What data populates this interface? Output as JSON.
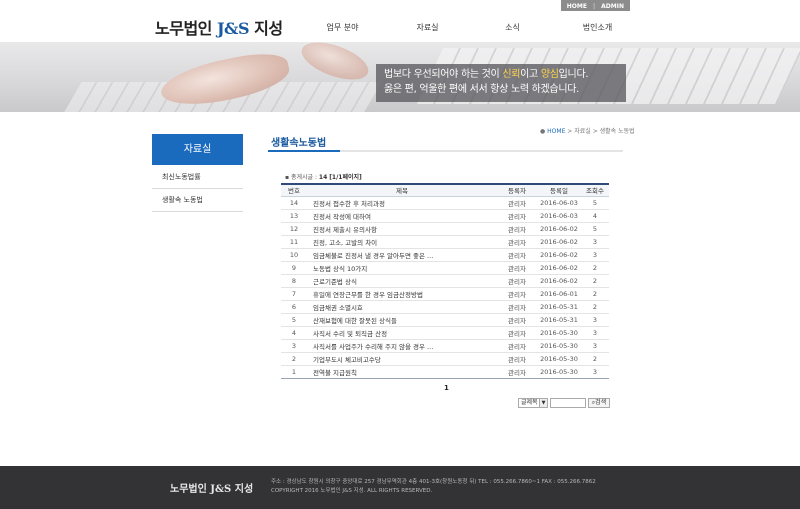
{
  "util": {
    "home": "HOME",
    "sep": "|",
    "admin": "ADMIN"
  },
  "header": {
    "logo_main": "노무법인 ",
    "logo_js": "J&S",
    "logo_tail": " 지성"
  },
  "nav": [
    "업무 분야",
    "자료실",
    "소식",
    "법인소개"
  ],
  "hero": {
    "line1_a": "법보다 우선되어야 하는 것이 ",
    "line1_hl1": "신뢰",
    "line1_b": "이고 ",
    "line1_hl2": "양심",
    "line1_c": "입니다.",
    "line2": "옳은 편, 억울한 편에 서서 항상 노력 하겠습니다."
  },
  "sidebar": {
    "title": "자료실",
    "items": [
      "최신노동법률",
      "생활속 노동법"
    ]
  },
  "page": {
    "title": "생활속노동법",
    "breadcrumb": {
      "home": "HOME",
      "sep1": " > ",
      "crumb1": "자료실",
      "sep2": " > ",
      "crumb2": "생활속 노동법"
    },
    "total_label": "총게시글 : ",
    "total_value": "14",
    "total_pages": "[1/1페이지]"
  },
  "board": {
    "headers": [
      "번호",
      "제목",
      "등록자",
      "등록일",
      "조회수"
    ],
    "rows": [
      {
        "no": "14",
        "title": "진정서 접수한 후 처리과정",
        "author": "관리자",
        "date": "2016-06-03",
        "views": "5"
      },
      {
        "no": "13",
        "title": "진정서 작성에 대하여",
        "author": "관리자",
        "date": "2016-06-03",
        "views": "4"
      },
      {
        "no": "12",
        "title": "진정서 제출시 유의사항",
        "author": "관리자",
        "date": "2016-06-02",
        "views": "5"
      },
      {
        "no": "11",
        "title": "진정, 고소, 고발의 차이",
        "author": "관리자",
        "date": "2016-06-02",
        "views": "3"
      },
      {
        "no": "10",
        "title": "임금체불로 진정서 낼 경우 알아두면 좋은 ...",
        "author": "관리자",
        "date": "2016-06-02",
        "views": "3"
      },
      {
        "no": "9",
        "title": "노동법 상식 10가지",
        "author": "관리자",
        "date": "2016-06-02",
        "views": "2"
      },
      {
        "no": "8",
        "title": "근로기준법 상식",
        "author": "관리자",
        "date": "2016-06-02",
        "views": "2"
      },
      {
        "no": "7",
        "title": "휴일에 연장근무를 한 경우 임금산정방법",
        "author": "관리자",
        "date": "2016-06-01",
        "views": "2"
      },
      {
        "no": "6",
        "title": "임금채권 소멸시효",
        "author": "관리자",
        "date": "2016-05-31",
        "views": "2"
      },
      {
        "no": "5",
        "title": "산재보험에 대한 잘못된 상식들",
        "author": "관리자",
        "date": "2016-05-31",
        "views": "3"
      },
      {
        "no": "4",
        "title": "사직서 수리 및 퇴직금 산정",
        "author": "관리자",
        "date": "2016-05-30",
        "views": "3"
      },
      {
        "no": "3",
        "title": "사직서를 사업주가 수리해 주지 않을 경우 ...",
        "author": "관리자",
        "date": "2016-05-30",
        "views": "3"
      },
      {
        "no": "2",
        "title": "기업부도시 체고비고수당",
        "author": "관리자",
        "date": "2016-05-30",
        "views": "2"
      },
      {
        "no": "1",
        "title": "전역불 지급원칙",
        "author": "관리자",
        "date": "2016-05-30",
        "views": "3"
      }
    ]
  },
  "paging": {
    "current": "1"
  },
  "search": {
    "select_value": "글제목",
    "button": "검색"
  },
  "footer": {
    "logo": "노무법인 J&S 지성",
    "address": "주소 : 경상남도 창원시 의창구 중앙대로 257 경남무역회관 4층 401-3호(창원노동청 뒤) TEL : 055.266.7860~1 FAX : 055.266.7862",
    "copyright": "COPYRIGHT 2016 노무법인 J&S 지성. ALL RIGHTS RESERVED."
  }
}
